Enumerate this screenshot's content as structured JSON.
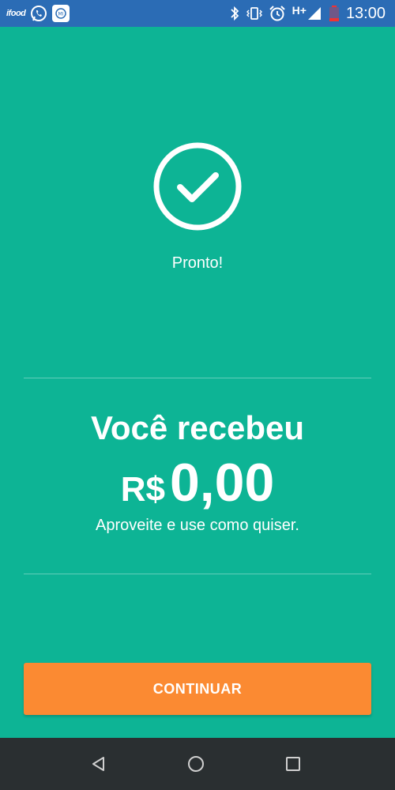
{
  "status_bar": {
    "app_icons": [
      "ifood-icon",
      "whatsapp-icon",
      "app-notification-icon"
    ],
    "ifood_label": "ifood",
    "system_icons": [
      "bluetooth-icon",
      "vibrate-icon",
      "alarm-icon",
      "signal-icon",
      "battery-icon"
    ],
    "network_label": "H+",
    "time": "13:00",
    "color": "#2b6cb5"
  },
  "main": {
    "background": "#0db495",
    "status_icon": "check-circle-icon",
    "status_text": "Pronto!",
    "headline": "Você recebeu",
    "currency": "R$",
    "amount": "0,00",
    "subtitle": "Aproveite e use como quiser."
  },
  "cta": {
    "label": "CONTINUAR",
    "color": "#fb8a32"
  },
  "nav_bar": {
    "buttons": [
      "back-icon",
      "home-icon",
      "recents-icon"
    ],
    "color": "#2a2f31"
  }
}
